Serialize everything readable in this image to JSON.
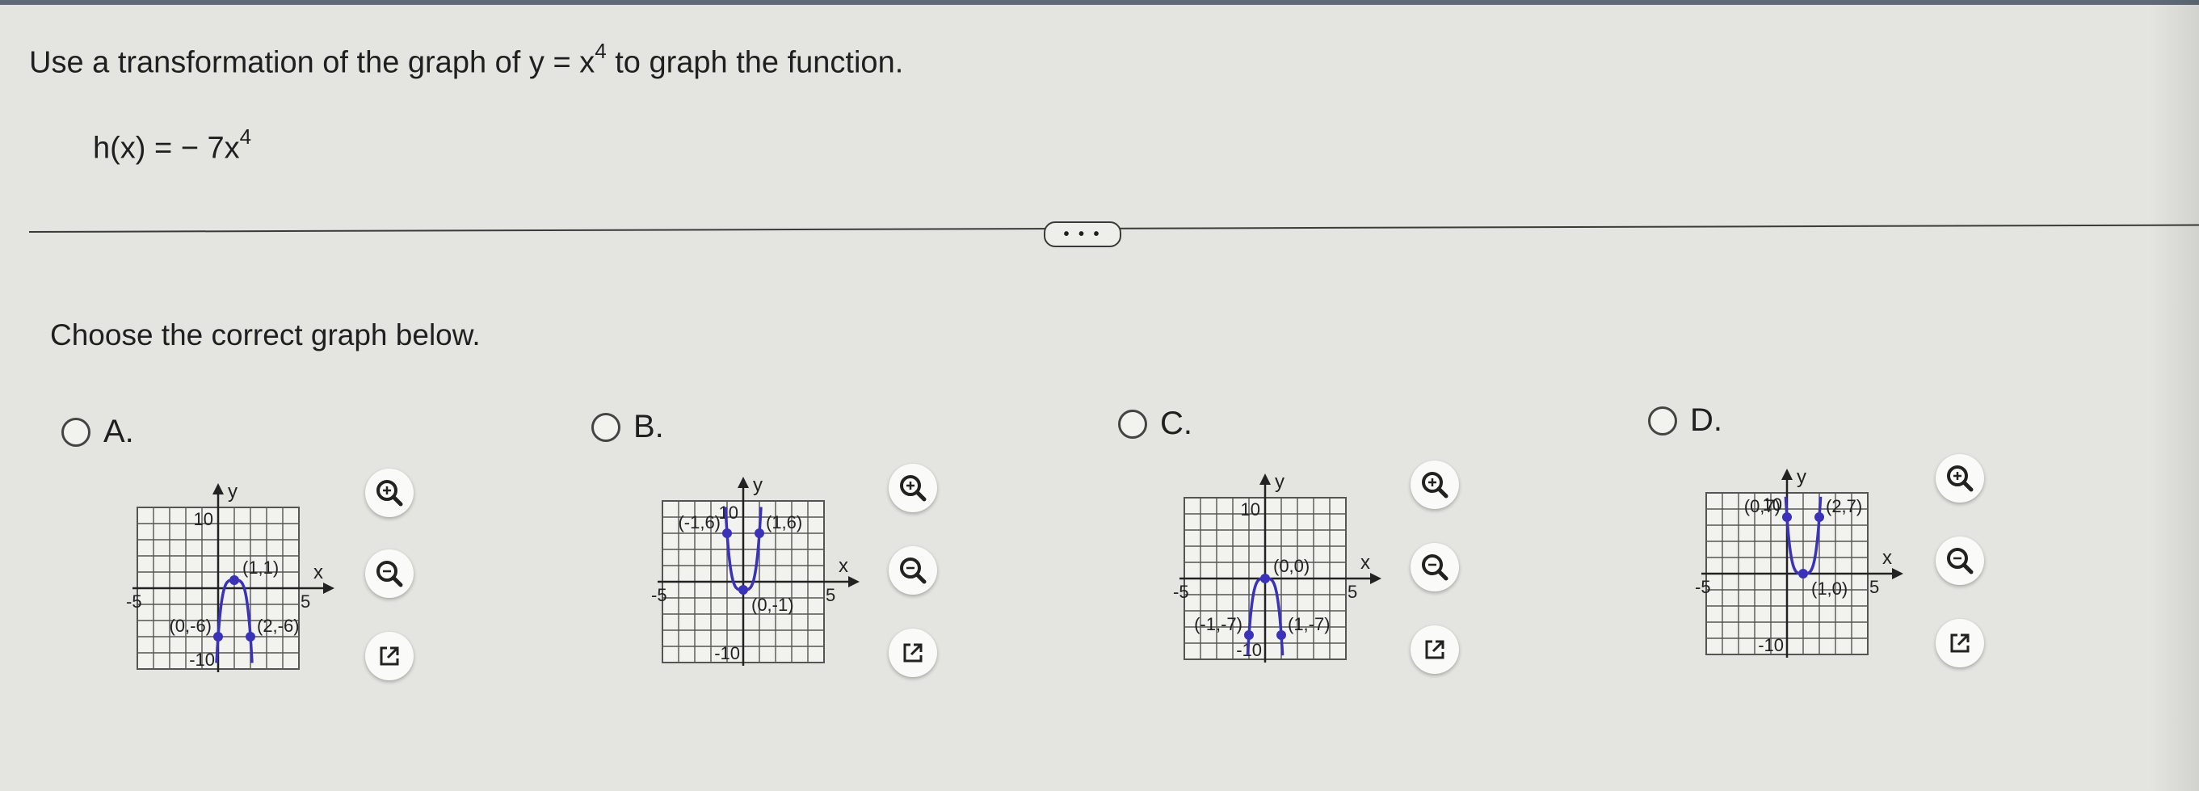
{
  "question": {
    "text_before": "Use a transformation of the graph of y = x",
    "exponent": "4",
    "text_after": " to graph the function."
  },
  "function": {
    "text": "h(x) = − 7x",
    "exponent": "4"
  },
  "more_button": {
    "label": "• • •"
  },
  "prompt": "Choose the correct graph below.",
  "options": [
    {
      "label": "A.",
      "graph": {
        "y_label": "y",
        "x_label": "x",
        "tick_y_pos": "10",
        "tick_y_neg": "-10",
        "tick_x_neg": "-5",
        "tick_x_pos": "5",
        "points": [
          {
            "x": 1,
            "y": 1,
            "label": "(1,1)"
          },
          {
            "x": 0,
            "y": -6,
            "label": "(0,-6)"
          },
          {
            "x": 2,
            "y": -6,
            "label": "(2,-6)"
          }
        ]
      }
    },
    {
      "label": "B.",
      "graph": {
        "y_label": "y",
        "x_label": "x",
        "tick_y_pos": "10",
        "tick_y_neg": "-10",
        "tick_x_neg": "-5",
        "tick_x_pos": "5",
        "points": [
          {
            "x": -1,
            "y": 6,
            "label": "(-1,6)"
          },
          {
            "x": 1,
            "y": 6,
            "label": "(1,6)"
          },
          {
            "x": 0,
            "y": -1,
            "label": "(0,-1)"
          }
        ]
      }
    },
    {
      "label": "C.",
      "graph": {
        "y_label": "y",
        "x_label": "x",
        "tick_y_pos": "10",
        "tick_y_neg": "-10",
        "tick_x_neg": "-5",
        "tick_x_pos": "5",
        "points": [
          {
            "x": 0,
            "y": 0,
            "label": "(0,0)"
          },
          {
            "x": -1,
            "y": -7,
            "label": "(-1,-7)"
          },
          {
            "x": 1,
            "y": -7,
            "label": "(1,-7)"
          }
        ]
      }
    },
    {
      "label": "D.",
      "graph": {
        "y_label": "y",
        "x_label": "x",
        "tick_y_pos": "10",
        "tick_y_neg": "-10",
        "tick_x_neg": "-5",
        "tick_x_pos": "5",
        "points": [
          {
            "x": 0,
            "y": 7,
            "label": "(0,7)"
          },
          {
            "x": 2,
            "y": 7,
            "label": "(2,7)"
          },
          {
            "x": 1,
            "y": 0,
            "label": "(1,0)"
          }
        ]
      }
    }
  ],
  "icons": {
    "zoom_in": "zoom-in-icon",
    "zoom_out": "zoom-out-icon",
    "open_new": "external-link-icon"
  },
  "colors": {
    "curve": "#3a32b8",
    "grid": "#555555",
    "axis": "#222222"
  }
}
